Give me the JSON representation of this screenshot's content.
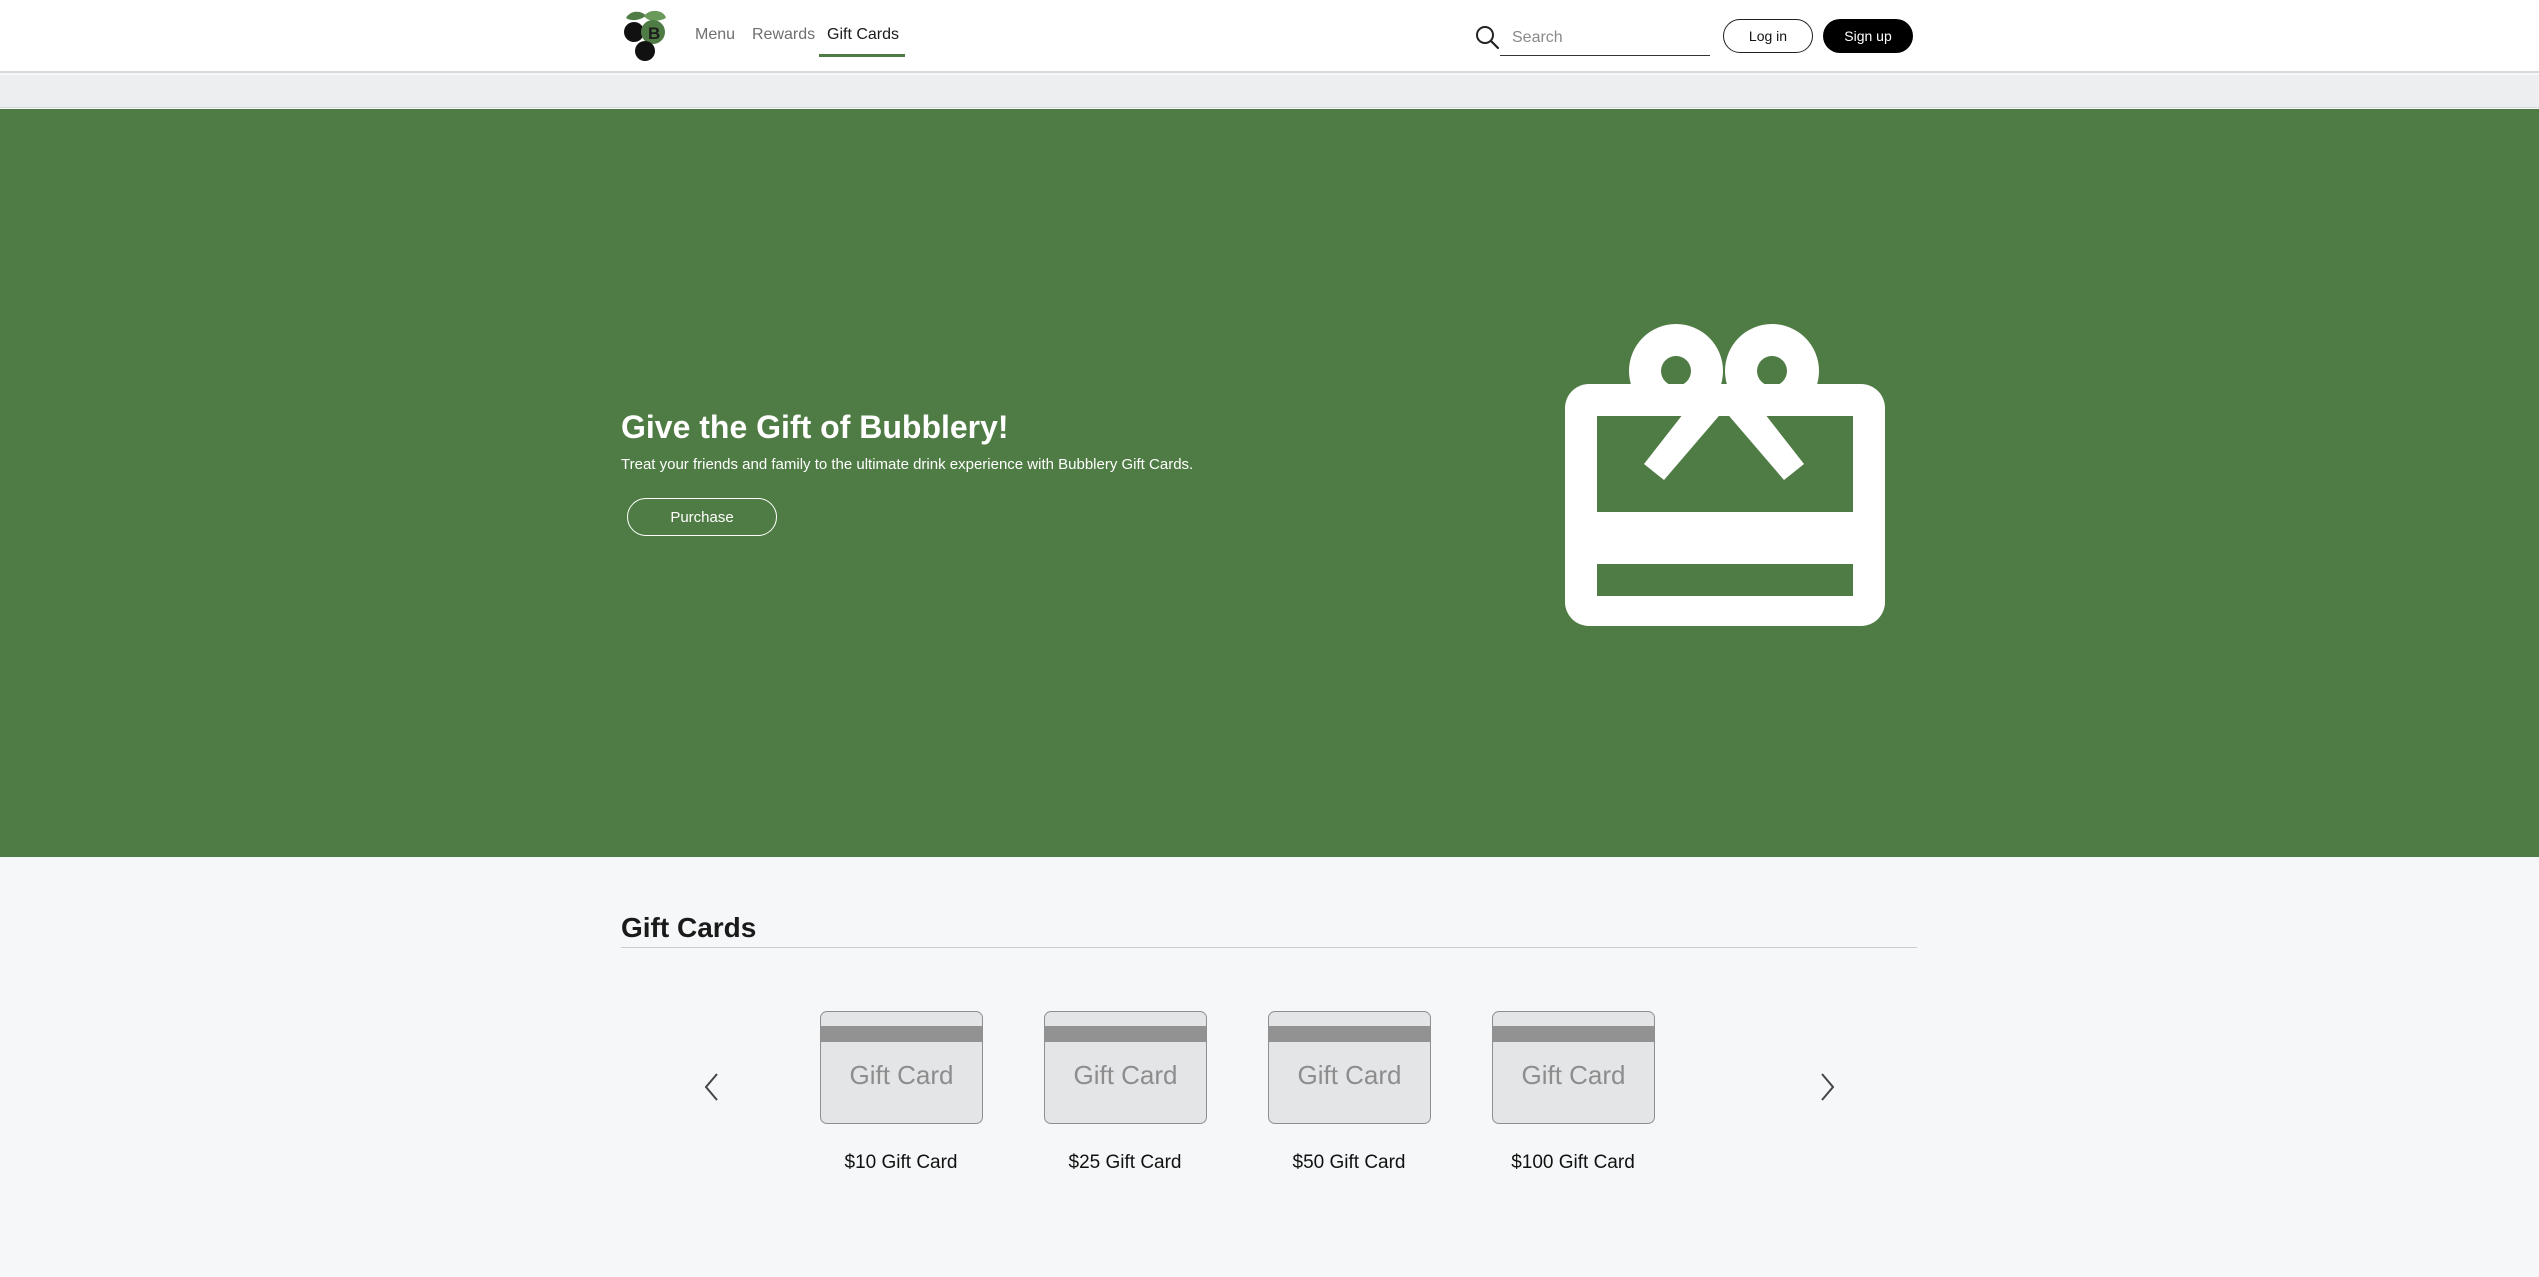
{
  "header": {
    "nav": [
      {
        "label": "Menu"
      },
      {
        "label": "Rewards"
      },
      {
        "label": "Gift Cards",
        "active": true
      }
    ],
    "search_placeholder": "Search",
    "login_label": "Log in",
    "signup_label": "Sign up"
  },
  "hero": {
    "title": "Give the Gift of Bubblery!",
    "subtitle": "Treat your friends and family to the ultimate drink experience with Bubblery Gift Cards.",
    "purchase_label": "Purchase",
    "background_color": "#4f7c44",
    "icon": "gift-card-icon"
  },
  "gift_cards": {
    "title": "Gift Cards",
    "prev_icon": "chevron-left-icon",
    "next_icon": "chevron-right-icon",
    "cards": [
      {
        "image_text": "Gift Card",
        "label": "$10 Gift Card"
      },
      {
        "image_text": "Gift Card",
        "label": "$25 Gift Card"
      },
      {
        "image_text": "Gift Card",
        "label": "$50 Gift Card"
      },
      {
        "image_text": "Gift Card",
        "label": "$100 Gift Card"
      }
    ]
  },
  "colors": {
    "accent": "#4f7c44",
    "signup_bg": "#000000"
  }
}
